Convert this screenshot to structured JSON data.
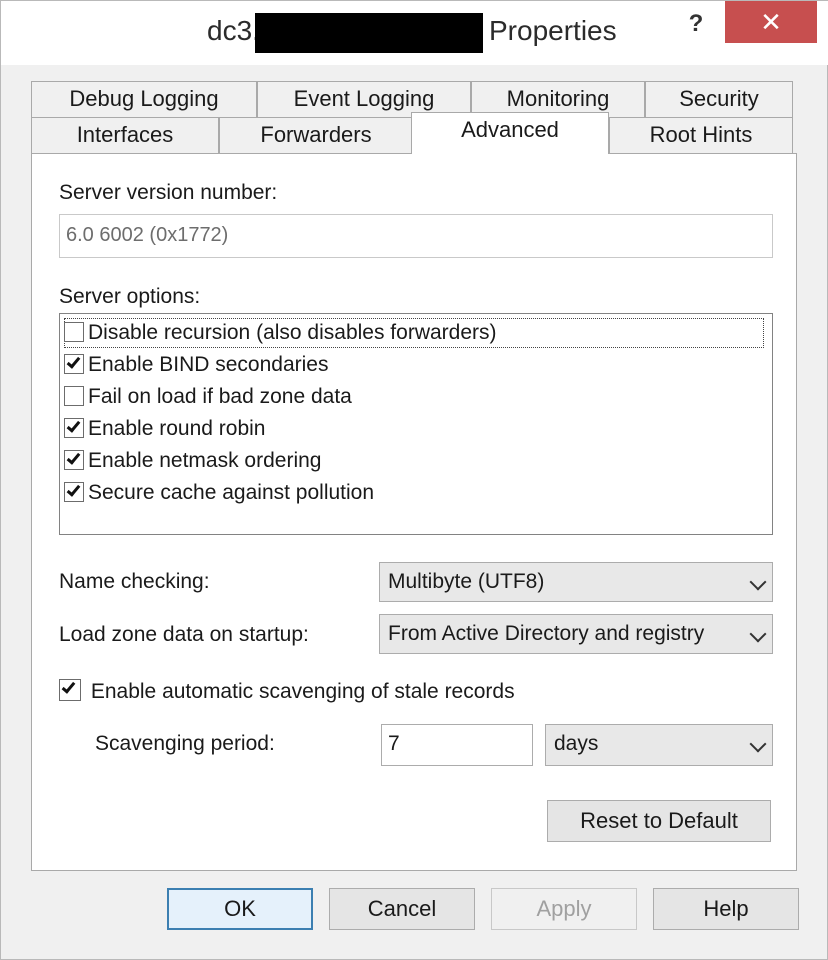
{
  "window": {
    "title_prefix": "dc3.",
    "title_suffix": "Properties",
    "help_glyph": "?",
    "close_glyph": "✕"
  },
  "tabs": {
    "row1": [
      "Debug Logging",
      "Event Logging",
      "Monitoring",
      "Security"
    ],
    "row2": [
      "Interfaces",
      "Forwarders",
      "Advanced",
      "Root Hints"
    ],
    "active": "Advanced"
  },
  "advanced": {
    "server_version_label": "Server version number:",
    "server_version_value": "6.0 6002 (0x1772)",
    "server_options_label": "Server options:",
    "server_options": [
      {
        "label": "Disable recursion (also disables forwarders)",
        "checked": false
      },
      {
        "label": "Enable BIND secondaries",
        "checked": true
      },
      {
        "label": "Fail on load if bad zone data",
        "checked": false
      },
      {
        "label": "Enable round robin",
        "checked": true
      },
      {
        "label": "Enable netmask ordering",
        "checked": true
      },
      {
        "label": "Secure cache against pollution",
        "checked": true
      }
    ],
    "name_checking_label": "Name checking:",
    "name_checking_value": "Multibyte (UTF8)",
    "load_zone_label": "Load zone data on startup:",
    "load_zone_value": "From Active Directory and registry",
    "scavenging_label": "Enable automatic scavenging of stale records",
    "scavenging_checked": true,
    "scavenging_period_label": "Scavenging period:",
    "scavenging_period_value": "7",
    "scavenging_unit": "days",
    "reset_button": "Reset to Default"
  },
  "buttons": {
    "ok": "OK",
    "cancel": "Cancel",
    "apply": "Apply",
    "help": "Help"
  }
}
